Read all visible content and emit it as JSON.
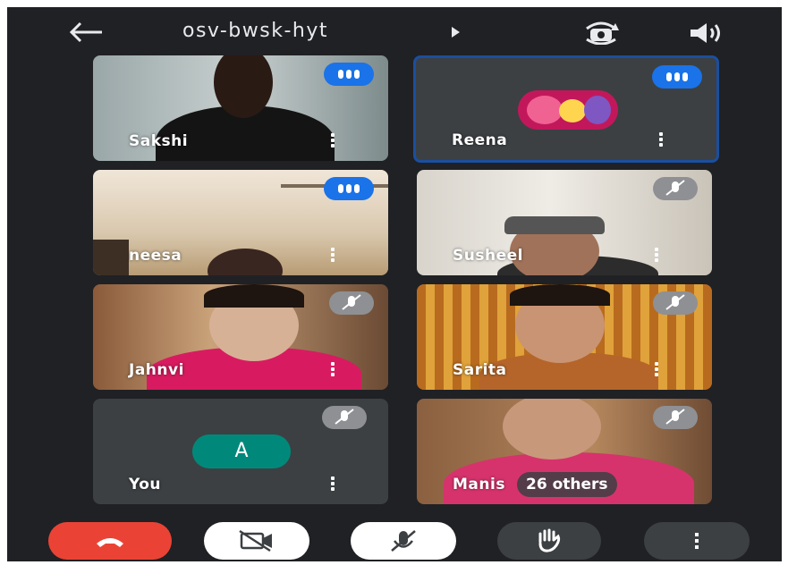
{
  "header": {
    "meeting_code": "osv-bwsk-hyt",
    "back_icon": "arrow-left-icon",
    "camera_switch_icon": "camera-flip-icon",
    "audio_icon": "speaker-icon"
  },
  "participants": [
    {
      "name": "Sakshi",
      "status": "speaking"
    },
    {
      "name": "Reena",
      "status": "speaking"
    },
    {
      "name": "neesa",
      "status": "speaking"
    },
    {
      "name": "Susheel",
      "status": "muted"
    },
    {
      "name": "Jahnvi",
      "status": "muted"
    },
    {
      "name": "Sarita",
      "status": "muted"
    },
    {
      "name": "You",
      "status": "muted",
      "avatar_letter": "A"
    },
    {
      "name": "Manis",
      "status": "muted",
      "others_label": "26 others"
    }
  ],
  "controls": {
    "end_call_icon": "phone-hangup-icon",
    "camera_off_icon": "camera-off-icon",
    "mic_off_icon": "mic-off-icon",
    "raise_hand_icon": "hand-icon",
    "more_icon": "more-vertical-icon"
  },
  "colors": {
    "background": "#202124",
    "tile": "#3c4043",
    "speaking": "#1a73e8",
    "end_call": "#ea4335",
    "avatar": "#00897b"
  }
}
